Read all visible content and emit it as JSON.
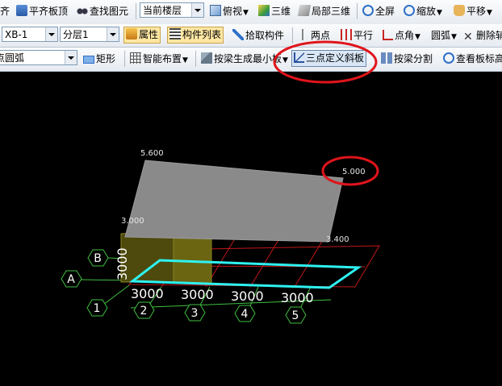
{
  "toolbar1": {
    "t0": "齐",
    "align_top": "平齐板顶",
    "find": "查找图元",
    "layer": "当前楼层",
    "view": "俯视",
    "three_d": "三维",
    "local_3d": "局部三维",
    "fullscreen": "全屏",
    "zoom": "缩放",
    "pan": "平移"
  },
  "toolbar2": {
    "component": "XB-1",
    "floor": "分层1",
    "props": "属性",
    "list": "构件列表",
    "pick": "拾取构件",
    "two_point": "两点",
    "parallel": "平行",
    "point_angle": "点角",
    "arc": "圆弧",
    "delete_aux": "删除辅"
  },
  "toolbar3": {
    "arc_mode": "点圆弧",
    "rect": "矩形",
    "smart": "智能布置",
    "beam_min": "按梁生成最小板",
    "three_point": "三点定义斜板",
    "beam_split": "按梁分割",
    "view_slab": "查看板标高"
  },
  "scene": {
    "elev_top_left": "5.600",
    "elev_top_right": "5.000",
    "elev_low": "3.000",
    "elev_right": "3.400",
    "axis_letters": [
      "A",
      "B"
    ],
    "axis_numbers": [
      "1",
      "2",
      "3",
      "4",
      "5"
    ],
    "span_x": [
      "3000",
      "3000",
      "3000",
      "3000"
    ],
    "span_y": "3000"
  },
  "colors": {
    "annotation": "#e0141b",
    "slab": "#8a8a8a",
    "column": "#6b6512",
    "cyan": "#2ef2f2",
    "axis_green": "#3fbf3f",
    "grid_red": "#c01818"
  }
}
